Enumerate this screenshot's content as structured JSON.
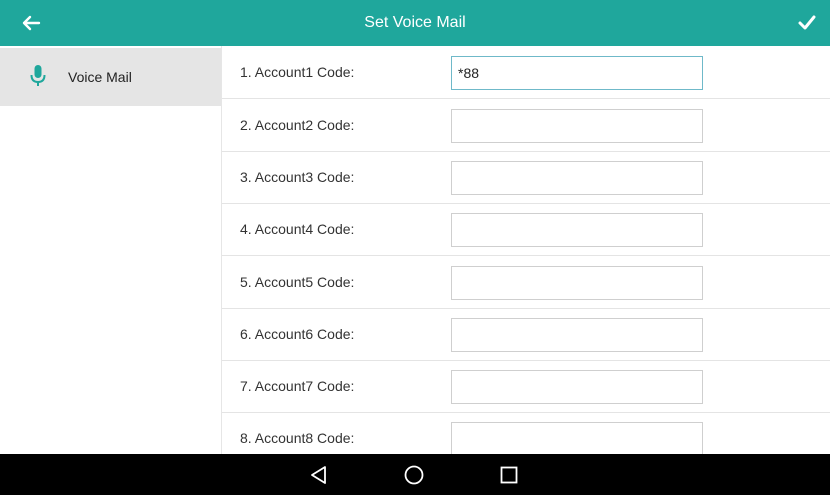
{
  "header": {
    "title": "Set Voice Mail",
    "back_icon": "arrow-left-icon",
    "confirm_icon": "checkmark-icon"
  },
  "sidebar": {
    "items": [
      {
        "label": "Voice Mail",
        "icon": "microphone-icon",
        "selected": true
      }
    ]
  },
  "accounts": [
    {
      "label": "1. Account1 Code:",
      "value": "*88"
    },
    {
      "label": "2. Account2 Code:",
      "value": ""
    },
    {
      "label": "3. Account3 Code:",
      "value": ""
    },
    {
      "label": "4. Account4 Code:",
      "value": ""
    },
    {
      "label": "5. Account5 Code:",
      "value": ""
    },
    {
      "label": "6. Account6 Code:",
      "value": ""
    },
    {
      "label": "7. Account7 Code:",
      "value": ""
    },
    {
      "label": "8. Account8 Code:",
      "value": ""
    }
  ],
  "navbar": {
    "icons": [
      "back-triangle-icon",
      "home-circle-icon",
      "recent-square-icon"
    ]
  },
  "colors": {
    "header": "#1fa79c",
    "mic": "#1fa79c",
    "navbar": "#000000",
    "selected_item": "#e5e5e5"
  }
}
